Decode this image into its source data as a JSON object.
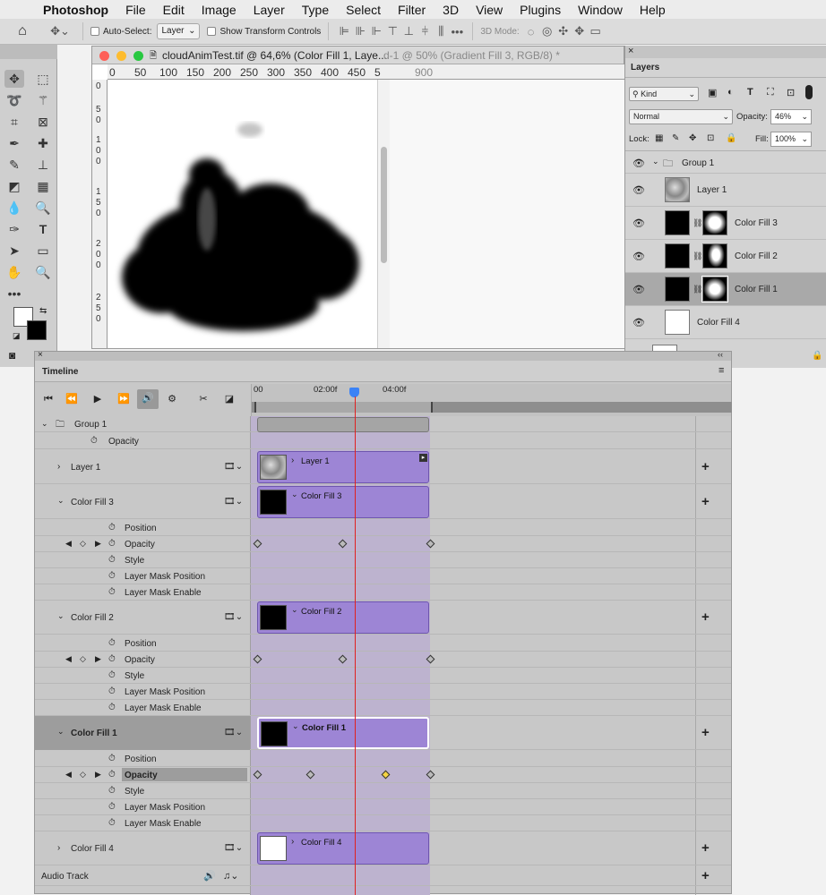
{
  "menubar": {
    "app": "Photoshop",
    "items": [
      "File",
      "Edit",
      "Image",
      "Layer",
      "Type",
      "Select",
      "Filter",
      "3D",
      "View",
      "Plugins",
      "Window",
      "Help"
    ]
  },
  "options": {
    "auto_select_label": "Auto-Select:",
    "auto_select_value": "Layer",
    "transform_label": "Show Transform Controls",
    "mode_3d_label": "3D Mode:"
  },
  "document": {
    "tab1_title": "cloudAnimTest.tif @ 64,6% (Color Fill 1, Laye...",
    "tab2_title": "d-1 @ 50% (Gradient Fill 3, RGB/8) *",
    "ruler_h": [
      "0",
      "50",
      "100",
      "150",
      "200",
      "250",
      "300",
      "350",
      "400",
      "450",
      "5"
    ],
    "ruler_v": [
      "0",
      "5",
      "0",
      "1",
      "0",
      "0",
      "1",
      "5",
      "0",
      "2",
      "0",
      "0",
      "2",
      "5",
      "0"
    ],
    "ruler2_label": "900"
  },
  "layers_panel": {
    "title": "Layers",
    "filter_label": "Kind",
    "blend_mode": "Normal",
    "opacity_label": "Opacity:",
    "opacity_value": "46%",
    "lock_label": "Lock:",
    "fill_label": "Fill:",
    "fill_value": "100%",
    "layers": [
      {
        "name": "Group 1",
        "type": "group"
      },
      {
        "name": "Layer 1",
        "type": "pixel"
      },
      {
        "name": "Color Fill 3",
        "type": "fill"
      },
      {
        "name": "Color Fill 2",
        "type": "fill"
      },
      {
        "name": "Color Fill 1",
        "type": "fill",
        "selected": true
      },
      {
        "name": "Color Fill 4",
        "type": "fill-white"
      }
    ]
  },
  "timeline": {
    "title": "Timeline",
    "time_labels": [
      "00",
      "02:00f",
      "04:00f"
    ],
    "rows": {
      "group1": "Group 1",
      "group1_opacity": "Opacity",
      "layer1": "Layer 1",
      "cf3": "Color Fill 3",
      "cf2": "Color Fill 2",
      "cf1": "Color Fill 1",
      "cf4": "Color Fill 4",
      "audio": "Audio Track"
    },
    "props": [
      "Position",
      "Opacity",
      "Style",
      "Layer Mask Position",
      "Layer Mask Enable"
    ],
    "clips": {
      "layer1": "Layer 1",
      "cf3": "Color Fill 3",
      "cf2": "Color Fill 2",
      "cf1": "Color Fill 1",
      "cf4": "Color Fill 4"
    }
  }
}
